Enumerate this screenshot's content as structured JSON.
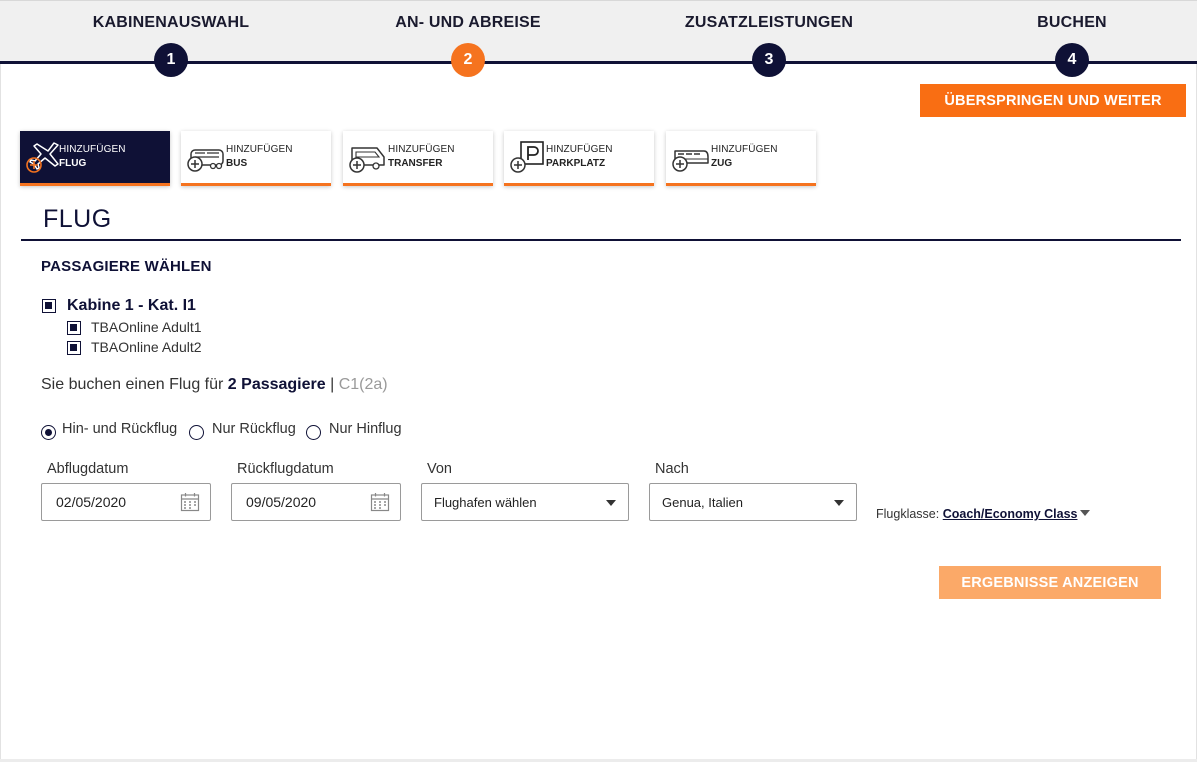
{
  "stepper": {
    "steps": [
      {
        "label": "KABINENAUSWAHL",
        "number": "1",
        "active": false
      },
      {
        "label": "AN- UND ABREISE",
        "number": "2",
        "active": true
      },
      {
        "label": "ZUSATZLEISTUNGEN",
        "number": "3",
        "active": false
      },
      {
        "label": "BUCHEN",
        "number": "4",
        "active": false
      }
    ]
  },
  "skip_button": "ÜBERSPRINGEN UND WEITER",
  "services": [
    {
      "add_label": "HINZUFÜGEN",
      "name": "FLUG",
      "icon": "plane-icon",
      "active": true
    },
    {
      "add_label": "HINZUFÜGEN",
      "name": "BUS",
      "icon": "bus-icon",
      "active": false
    },
    {
      "add_label": "HINZUFÜGEN",
      "name": "TRANSFER",
      "icon": "van-icon",
      "active": false
    },
    {
      "add_label": "HINZUFÜGEN",
      "name": "PARKPLATZ",
      "icon": "parking-icon",
      "active": false
    },
    {
      "add_label": "HINZUFÜGEN",
      "name": "ZUG",
      "icon": "train-icon",
      "active": false
    }
  ],
  "flight": {
    "title": "FLUG",
    "passengers_heading": "PASSAGIERE WÄHLEN",
    "cabin": {
      "label": "Kabine 1 - Kat. I1",
      "checked": true
    },
    "passengers": [
      {
        "name": "TBAOnline Adult1",
        "checked": true
      },
      {
        "name": "TBAOnline Adult2",
        "checked": true
      }
    ],
    "booking_info": {
      "prefix": "Sie buchen einen Flug für",
      "count": "2 Passagiere",
      "separator": "|",
      "code": "C1(2a)"
    },
    "trip_types": [
      {
        "label": "Hin- und Rückflug",
        "checked": true
      },
      {
        "label": "Nur Rückflug",
        "checked": false
      },
      {
        "label": "Nur Hinflug",
        "checked": false
      }
    ],
    "fields": {
      "departure": {
        "label": "Abflugdatum",
        "value": "02/05/2020"
      },
      "return": {
        "label": "Rückflugdatum",
        "value": "09/05/2020"
      },
      "from": {
        "label": "Von",
        "value": "Flughafen wählen"
      },
      "to": {
        "label": "Nach",
        "value": "Genua, Italien"
      }
    },
    "flight_class": {
      "label": "Flugklasse:",
      "value": "Coach/Economy Class"
    },
    "results_button": "ERGEBNISSE ANZEIGEN"
  },
  "colors": {
    "navy": "#0f1136",
    "orange": "#f96e13",
    "orange_light": "#fba968"
  }
}
